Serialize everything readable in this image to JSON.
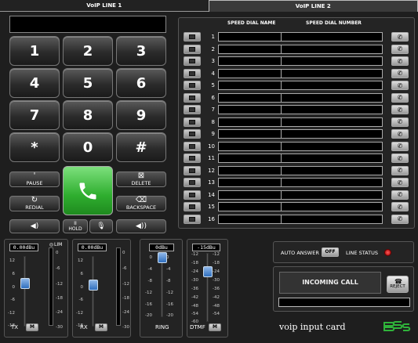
{
  "tabs": [
    "VoIP LINE 1",
    "VoIP LINE 2"
  ],
  "keypad": {
    "keys": [
      "1",
      "2",
      "3",
      "4",
      "5",
      "6",
      "7",
      "8",
      "9",
      "*",
      "0",
      "#"
    ],
    "pause": {
      "sym": "'",
      "label": "PAUSE"
    },
    "delete": {
      "sym": "⊠",
      "label": "DELETE"
    },
    "redial": {
      "sym": "↻",
      "label": "REDIAL"
    },
    "backspace": {
      "sym": "⌫",
      "label": "BACKSPACE"
    },
    "hold": {
      "sym": "II",
      "label": "HOLD"
    }
  },
  "speed_dial": {
    "name_header": "SPEED DIAL NAME",
    "number_header": "SPEED DIAL NUMBER",
    "rows": [
      "1",
      "2",
      "3",
      "4",
      "5",
      "6",
      "7",
      "8",
      "9",
      "10",
      "11",
      "12",
      "13",
      "14",
      "15",
      "16"
    ]
  },
  "strips": {
    "tx": {
      "label": "TX",
      "readout": "0.00dBu",
      "lim": "LIM",
      "mute": "M",
      "scale": [
        "12",
        "6",
        "0",
        "-6",
        "-12",
        "-18"
      ],
      "meter_scale": [
        "0",
        "-6",
        "-12",
        "-18",
        "-24",
        "-30"
      ]
    },
    "rx": {
      "label": "RX",
      "readout": "0.00dBu",
      "mute": "M",
      "scale": [
        "12",
        "6",
        "0",
        "-6",
        "-12",
        "-18"
      ],
      "meter_scale": [
        "0",
        "-6",
        "-12",
        "-18",
        "-24",
        "-30"
      ]
    },
    "ring": {
      "label": "RING",
      "readout": "0dBu",
      "scale": [
        "0",
        "-4",
        "-8",
        "-12",
        "-16",
        "-20"
      ]
    },
    "dtmf": {
      "label": "DTMF",
      "readout": "-15dBu",
      "mute": "M",
      "scale": [
        "-12",
        "-18",
        "-24",
        "-30",
        "-36",
        "-42",
        "-48",
        "-54",
        "-60"
      ]
    }
  },
  "auto_answer": {
    "label": "AUTO ANSWER",
    "state": "OFF"
  },
  "line_status": {
    "label": "LINE STATUS",
    "color": "#d42020"
  },
  "call": {
    "status": "INCOMING CALL",
    "reject": "REJECT"
  },
  "card_name": "voip input card",
  "colors": {
    "call_green": "#2fae2f",
    "fader_blue": "#2f6fbf",
    "logo_green": "#2fb33a"
  }
}
